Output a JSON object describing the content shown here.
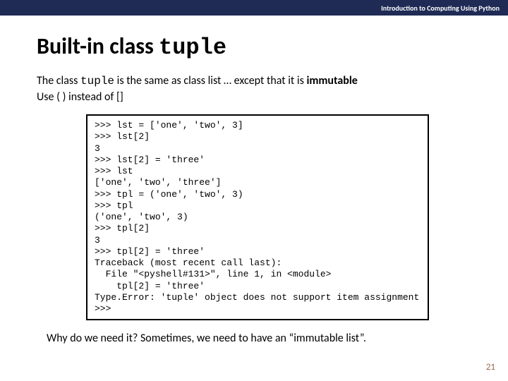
{
  "header": {
    "course": "Introduction to Computing Using Python"
  },
  "title": {
    "prefix": "Built-in class ",
    "mono": "tuple"
  },
  "intro": {
    "line1_a": "The class ",
    "line1_mono": "tuple",
    "line1_b": " is the same as class list … except that it is ",
    "line1_bold": "immutable",
    "line2": "Use ( ) instead of []"
  },
  "code": ">>> lst = ['one', 'two', 3]\n>>> lst[2]\n3\n>>> lst[2] = 'three'\n>>> lst\n['one', 'two', 'three']\n>>> tpl = ('one', 'two', 3)\n>>> tpl\n('one', 'two', 3)\n>>> tpl[2]\n3\n>>> tpl[2] = 'three'\nTraceback (most recent call last):\n  File \"<pyshell#131>\", line 1, in <module>\n    tpl[2] = 'three'\nType.Error: 'tuple' object does not support item assignment\n>>>",
  "why": "Why do we need it?  Sometimes, we need to have an “immutable list”.",
  "page": "21"
}
